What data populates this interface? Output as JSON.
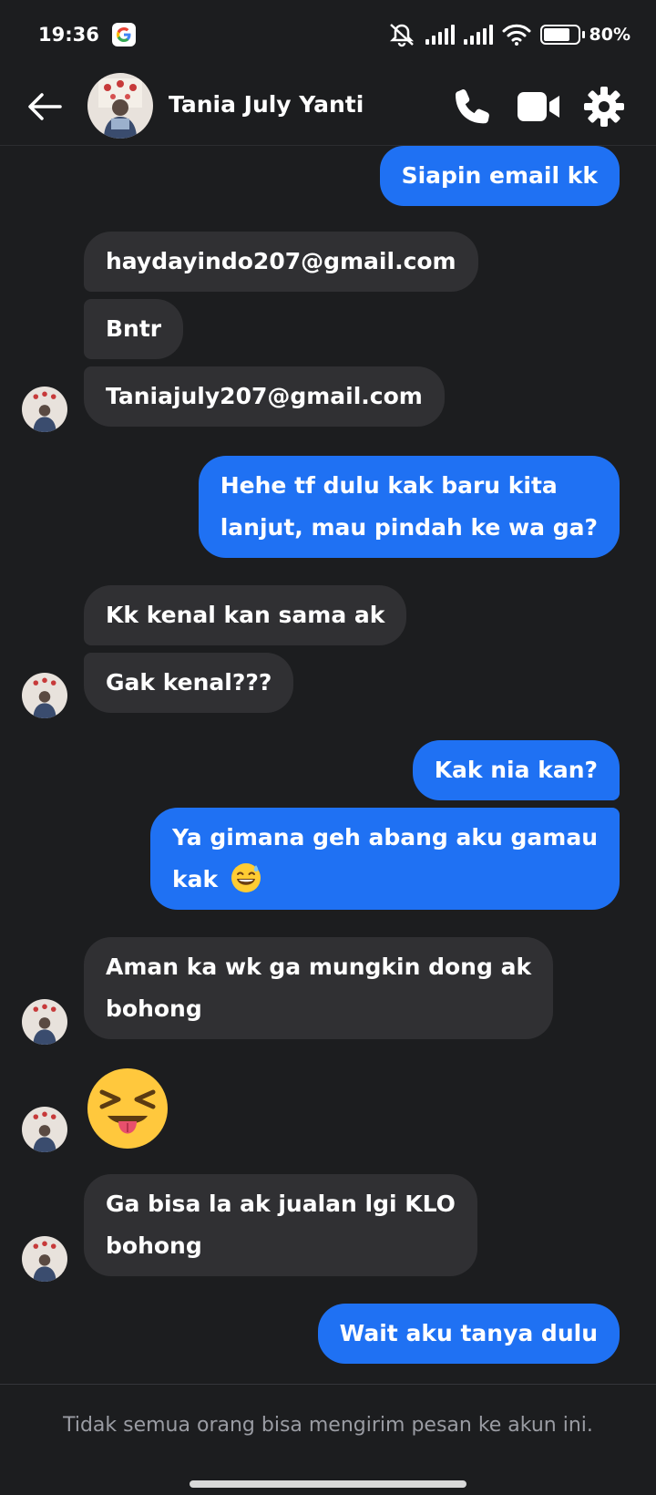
{
  "status_bar": {
    "time": "19:36",
    "battery": "80%",
    "battery_level": 0.8
  },
  "header": {
    "contact_name": "Tania July Yanti"
  },
  "messages": [
    {
      "dir": "out",
      "text": "Siapin email kk"
    },
    {
      "dir": "in",
      "text": "haydayindo207@gmail.com"
    },
    {
      "dir": "in",
      "text": "Bntr"
    },
    {
      "dir": "in",
      "text": "Taniajuly207@gmail.com"
    },
    {
      "dir": "out",
      "line1": "Hehe tf dulu kak baru kita",
      "line2": "lanjut, mau pindah ke wa ga?"
    },
    {
      "dir": "in",
      "text": "Kk kenal kan sama ak"
    },
    {
      "dir": "in",
      "text": "Gak kenal???"
    },
    {
      "dir": "out",
      "text": "Kak nia kan?"
    },
    {
      "dir": "out",
      "line1": "Ya gimana geh abang aku gamau",
      "line2": "kak"
    },
    {
      "dir": "in",
      "line1": "Aman ka wk ga mungkin dong ak",
      "line2": "bohong"
    },
    {
      "dir": "in",
      "emoji": "squinting-face-with-tongue"
    },
    {
      "dir": "in",
      "line1": "Ga bisa la ak jualan lgi KLO",
      "line2": "bohong"
    },
    {
      "dir": "out",
      "text": "Wait aku tanya dulu"
    }
  ],
  "footer": {
    "notice": "Tidak semua orang bisa mengirim pesan ke akun ini."
  },
  "colors": {
    "background": "#1c1d1f",
    "outgoing": "#1f71f3",
    "incoming": "#303033"
  }
}
